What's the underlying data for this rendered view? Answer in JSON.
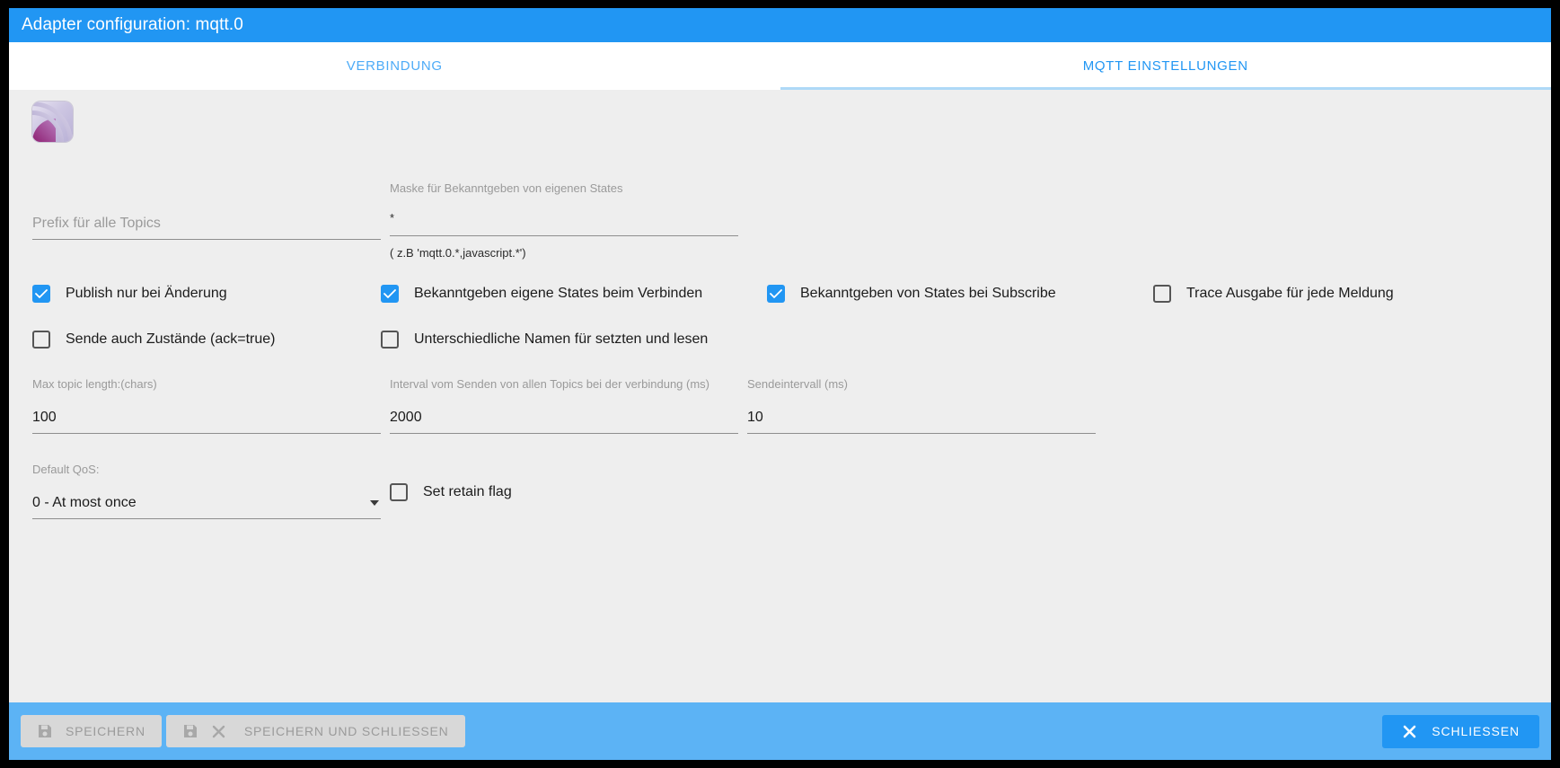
{
  "window": {
    "title": "Adapter configuration: mqtt.0"
  },
  "tabs": [
    {
      "label": "VERBINDUNG",
      "active": false
    },
    {
      "label": "MQTT EINSTELLUNGEN",
      "active": true
    }
  ],
  "logo": {
    "name": "mqtt-adapter-logo"
  },
  "fields": {
    "prefix": {
      "label": "",
      "placeholder": "Prefix für alle Topics",
      "value": ""
    },
    "mask": {
      "label": "Maske für Bekanntgeben von eigenen States",
      "value": "*",
      "hint": "( z.B 'mqtt.0.*,javascript.*')"
    },
    "max_topic_length": {
      "label": "Max topic length:(chars)",
      "value": "100"
    },
    "send_interval_all": {
      "label": "Interval vom Senden von allen Topics bei der verbindung (ms)",
      "value": "2000"
    },
    "send_interval": {
      "label": "Sendeintervall (ms)",
      "value": "10"
    },
    "default_qos": {
      "label": "Default QoS:",
      "value": "0 - At most once"
    }
  },
  "checkboxes": {
    "publish_on_change": {
      "label": "Publish nur bei Änderung",
      "checked": true
    },
    "announce_own_states": {
      "label": "Bekanntgeben eigene States beim Verbinden",
      "checked": true
    },
    "announce_on_subscribe": {
      "label": "Bekanntgeben von States bei Subscribe",
      "checked": true
    },
    "trace_output": {
      "label": "Trace Ausgabe für jede Meldung",
      "checked": false
    },
    "send_ack_true": {
      "label": "Sende auch Zustände (ack=true)",
      "checked": false
    },
    "different_names": {
      "label": "Unterschiedliche Namen für setzten und lesen",
      "checked": false
    },
    "set_retain_flag": {
      "label": "Set retain flag",
      "checked": false
    }
  },
  "footer": {
    "save": {
      "label": "SPEICHERN",
      "icon": "save-icon",
      "disabled": true
    },
    "save_close": {
      "label": "SPEICHERN UND SCHLIESSEN",
      "icon": "save-icon",
      "icon2": "close-icon",
      "disabled": true
    },
    "close": {
      "label": "SCHLIESSEN",
      "icon": "close-icon"
    }
  },
  "colors": {
    "accent": "#2196f3",
    "footer_bg": "#5cb3f5",
    "content_bg": "#eeeeee",
    "label_gray": "#9a9a9a"
  }
}
